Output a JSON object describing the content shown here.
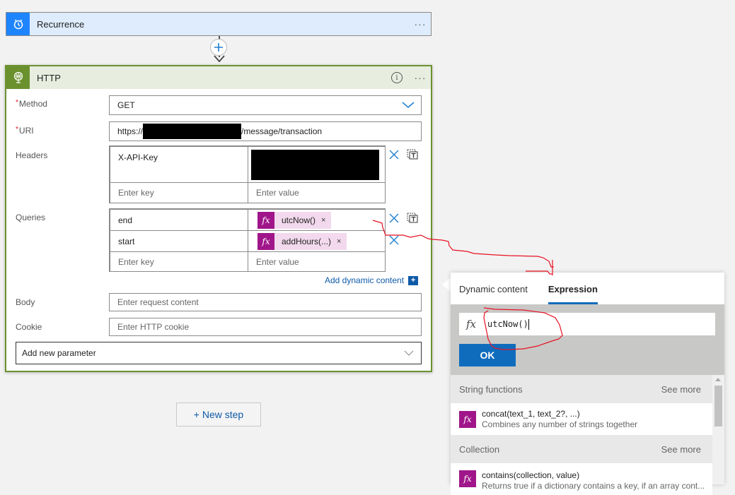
{
  "recurrence": {
    "title": "Recurrence",
    "icon": "alarm-clock-icon",
    "menu_label": "···",
    "color": "#1f85ff"
  },
  "connector": {
    "add_icon": "plus-icon",
    "arrow_icon": "arrow-down-icon"
  },
  "http": {
    "title": "HTTP",
    "icon": "globe-icon",
    "info_label": "i",
    "menu_label": "···",
    "color": "#6b912f",
    "method": {
      "label": "Method",
      "required": "*",
      "value": "GET"
    },
    "uri": {
      "label": "URI",
      "required": "*",
      "prefix": "https://",
      "suffix": "/message/transaction"
    },
    "headers": {
      "label": "Headers",
      "rows": [
        {
          "key": "X-API-Key",
          "value": ""
        }
      ],
      "key_placeholder": "Enter key",
      "value_placeholder": "Enter value"
    },
    "queries": {
      "label": "Queries",
      "rows": [
        {
          "key": "end",
          "token": "utcNow()"
        },
        {
          "key": "start",
          "token": "addHours(...)"
        }
      ],
      "key_placeholder": "Enter key",
      "value_placeholder": "Enter value",
      "remove_label": "×"
    },
    "add_dynamic_content": "Add dynamic content",
    "add_dynamic_plus": "+",
    "body": {
      "label": "Body",
      "placeholder": "Enter request content"
    },
    "cookie": {
      "label": "Cookie",
      "placeholder": "Enter HTTP cookie"
    },
    "add_parameter": "Add new parameter"
  },
  "new_step": "+ New step",
  "panel": {
    "tabs": [
      {
        "label": "Dynamic content",
        "active": false
      },
      {
        "label": "Expression",
        "active": true
      }
    ],
    "fx_label": "fx",
    "expression_value": "utcNow()",
    "ok_label": "OK",
    "sections": [
      {
        "title": "String functions",
        "see_more": "See more",
        "items": [
          {
            "name": "concat(text_1, text_2?, ...)",
            "desc": "Combines any number of strings together"
          }
        ]
      },
      {
        "title": "Collection",
        "see_more": "See more",
        "items": [
          {
            "name": "contains(collection, value)",
            "desc": "Returns true if a dictionary contains a key, if an array cont..."
          }
        ]
      }
    ],
    "accent": "#0f6cbd"
  },
  "token_fx": "fx"
}
